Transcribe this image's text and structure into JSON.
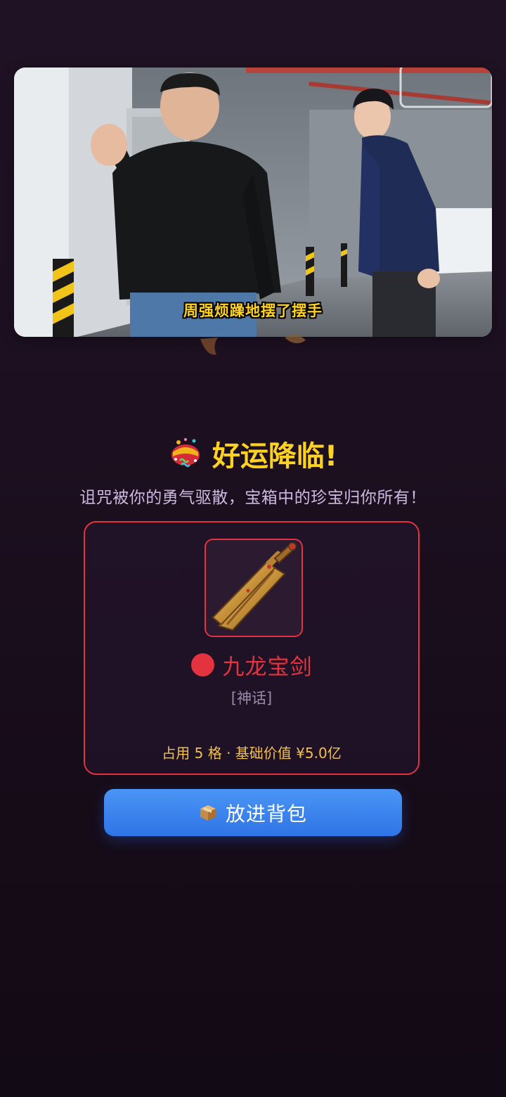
{
  "video": {
    "subtitle": "周强烦躁地摆了摆手"
  },
  "result": {
    "title": "好运降临!",
    "title_icon": "party-popper-icon",
    "message": "诅咒被你的勇气驱散，宝箱中的珍宝归你所有！"
  },
  "reward": {
    "image_icon": "sword-icon",
    "name": "九龙宝剑",
    "rarity_color": "#e2333f",
    "tier": "[神话]",
    "meta": "占用 5 格 · 基础价值 ¥5.0亿"
  },
  "actions": {
    "bag_button_icon": "package-icon",
    "bag_button_label": "放进背包"
  },
  "colors": {
    "accent_yellow": "#ffd21f",
    "mythic_red": "#e2333f",
    "button_blue": "#3b82f6"
  }
}
